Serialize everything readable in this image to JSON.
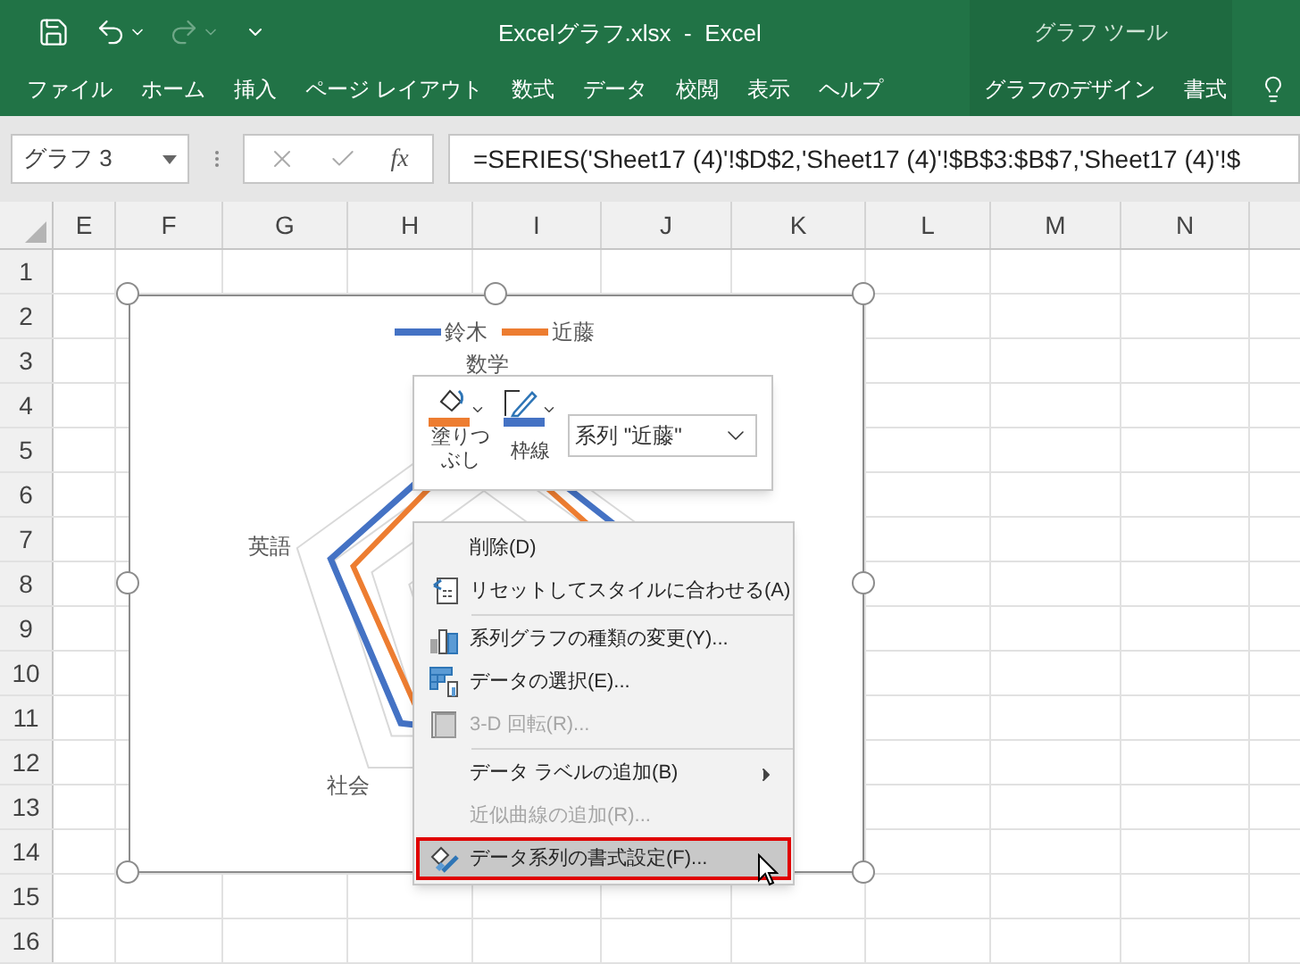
{
  "title_bar": {
    "title": "Excelグラフ.xlsx  -  Excel",
    "context_group": "グラフ ツール"
  },
  "ribbon_tabs": [
    {
      "label": "ファイル"
    },
    {
      "label": "ホーム"
    },
    {
      "label": "挿入"
    },
    {
      "label": "ページ レイアウト"
    },
    {
      "label": "数式"
    },
    {
      "label": "データ"
    },
    {
      "label": "校閲"
    },
    {
      "label": "表示"
    },
    {
      "label": "ヘルプ"
    }
  ],
  "context_tabs": [
    {
      "label": "グラフのデザイン"
    },
    {
      "label": "書式"
    }
  ],
  "name_box": {
    "value": "グラフ 3"
  },
  "formula_bar": {
    "fx": "fx",
    "value": "=SERIES('Sheet17 (4)'!$D$2,'Sheet17 (4)'!$B$3:$B$7,'Sheet17 (4)'!$"
  },
  "columns": [
    "E",
    "F",
    "G",
    "H",
    "I",
    "J",
    "K",
    "L",
    "M",
    "N"
  ],
  "rows": [
    "1",
    "2",
    "3",
    "4",
    "5",
    "6",
    "7",
    "8",
    "9",
    "10",
    "11",
    "12",
    "13",
    "14",
    "15",
    "16"
  ],
  "chart": {
    "legend": [
      {
        "name": "鈴木",
        "color": "#4472c4"
      },
      {
        "name": "近藤",
        "color": "#ed7d31"
      }
    ],
    "axis_labels": [
      "数学",
      "英語",
      "社会"
    ]
  },
  "mini_toolbar": {
    "fill_label": "塗りつぶし",
    "outline_label": "枠線",
    "series_select": "系列 \"近藤\""
  },
  "context_menu": {
    "groups": [
      [
        {
          "label": "削除(D)",
          "kind": "none",
          "disabled": false,
          "selected": false,
          "submenu": false
        },
        {
          "label": "リセットしてスタイルに合わせる(A)",
          "kind": "reset",
          "disabled": false,
          "selected": false,
          "submenu": false
        }
      ],
      [
        {
          "label": "系列グラフの種類の変更(Y)...",
          "kind": "chart",
          "disabled": false,
          "selected": false,
          "submenu": false
        },
        {
          "label": "データの選択(E)...",
          "kind": "table",
          "disabled": false,
          "selected": false,
          "submenu": false
        },
        {
          "label": "3-D 回転(R)...",
          "kind": "cube",
          "disabled": true,
          "selected": false,
          "submenu": false
        }
      ],
      [
        {
          "label": "データ ラベルの追加(B)",
          "kind": "none",
          "disabled": false,
          "selected": false,
          "submenu": true
        },
        {
          "label": "近似曲線の追加(R)...",
          "kind": "none",
          "disabled": true,
          "selected": false,
          "submenu": false
        },
        {
          "label": "データ系列の書式設定(F)...",
          "kind": "format",
          "disabled": false,
          "selected": true,
          "submenu": false
        }
      ]
    ]
  }
}
